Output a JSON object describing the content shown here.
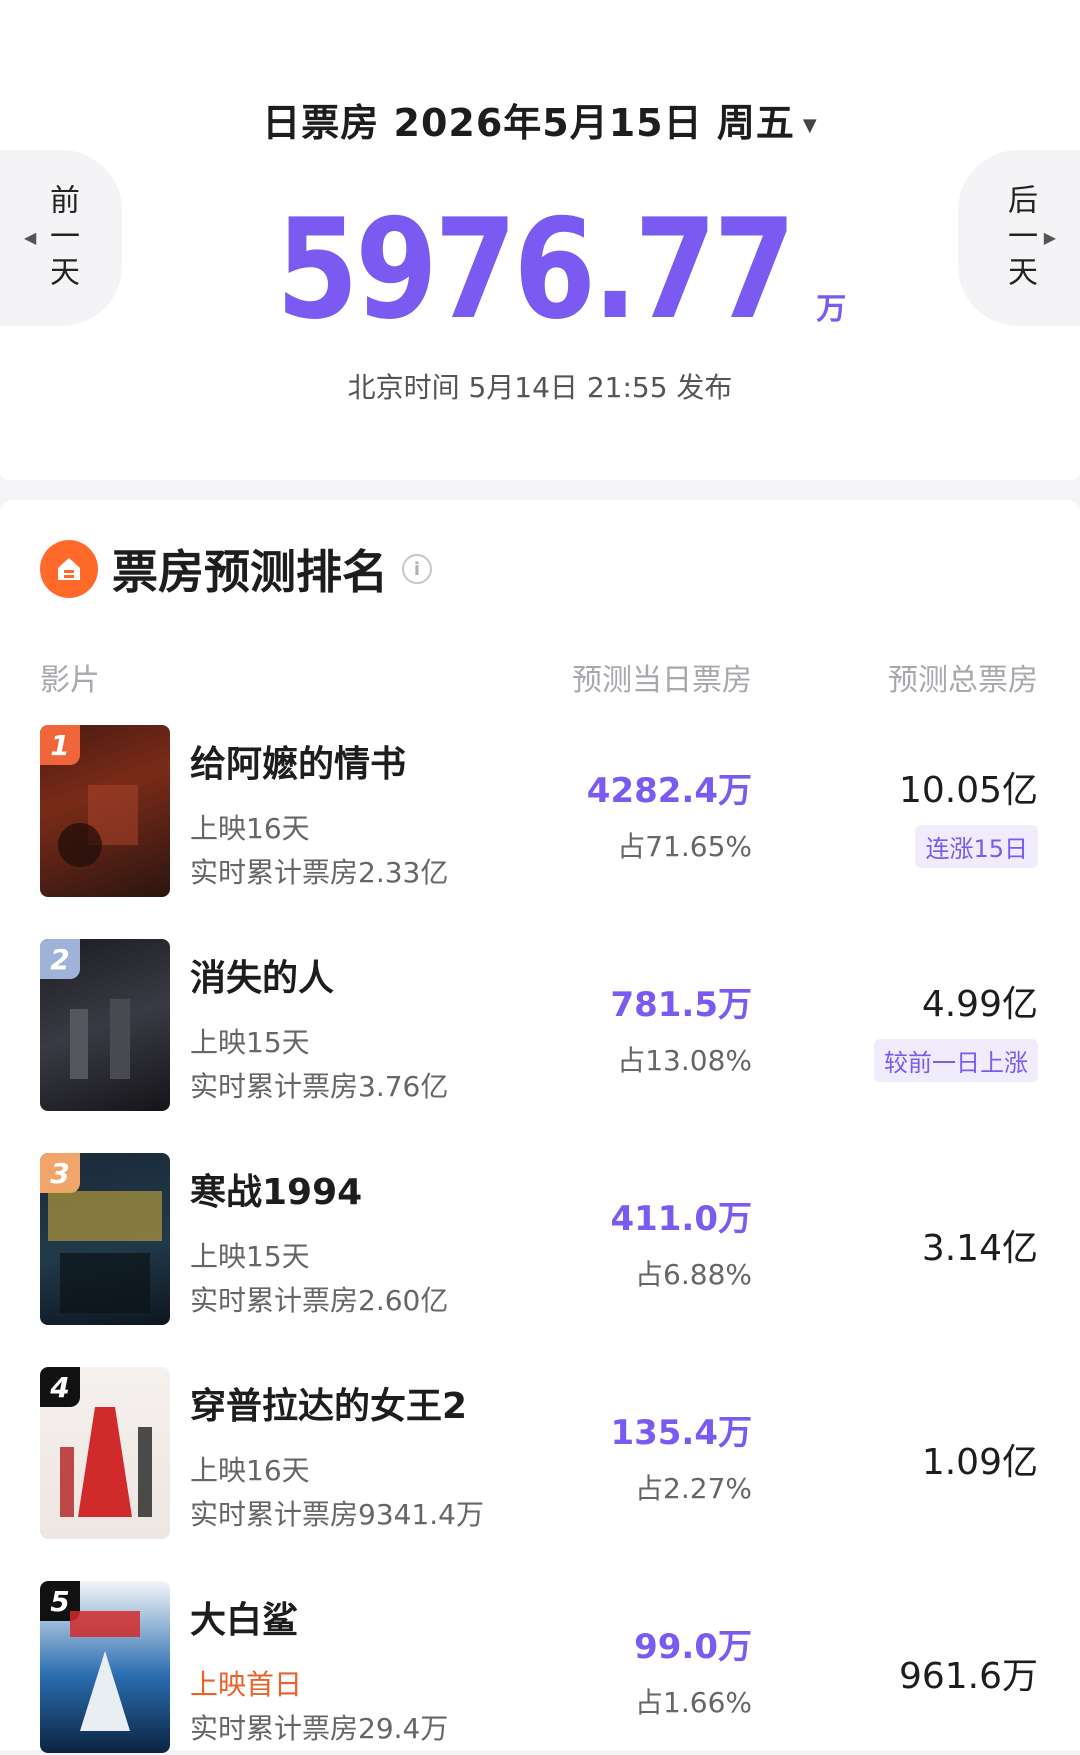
{
  "header": {
    "date_title": "日票房 2026年5月15日 周五",
    "caret": "▼",
    "prev_label": "前一天",
    "next_label": "后一天",
    "total_value": "5976.77",
    "total_unit": "万",
    "publish_time": "北京时间 5月14日 21:55 发布"
  },
  "section": {
    "title": "票房预测排名",
    "info": "i",
    "columns": {
      "film": "影片",
      "day": "预测当日票房",
      "total": "预测总票房"
    }
  },
  "films": [
    {
      "rank": "1",
      "title": "给阿嬷的情书",
      "days": "上映16天",
      "cumulative": "实时累计票房2.33亿",
      "day_box": "4282.4万",
      "share": "占71.65%",
      "total": "10.05亿",
      "badge": "连涨15日"
    },
    {
      "rank": "2",
      "title": "消失的人",
      "days": "上映15天",
      "cumulative": "实时累计票房3.76亿",
      "day_box": "781.5万",
      "share": "占13.08%",
      "total": "4.99亿",
      "badge": "较前一日上涨"
    },
    {
      "rank": "3",
      "title": "寒战1994",
      "days": "上映15天",
      "cumulative": "实时累计票房2.60亿",
      "day_box": "411.0万",
      "share": "占6.88%",
      "total": "3.14亿",
      "badge": ""
    },
    {
      "rank": "4",
      "title": "穿普拉达的女王2",
      "days": "上映16天",
      "cumulative": "实时累计票房9341.4万",
      "day_box": "135.4万",
      "share": "占2.27%",
      "total": "1.09亿",
      "badge": ""
    },
    {
      "rank": "5",
      "title": "大白鲨",
      "days": "上映首日",
      "cumulative": "实时累计票房29.4万",
      "day_box": "99.0万",
      "share": "占1.66%",
      "total": "961.6万",
      "badge": ""
    }
  ],
  "colors": {
    "accent": "#7a5af0",
    "logo": "#ff6a2b",
    "first_day": "#e8622c"
  }
}
